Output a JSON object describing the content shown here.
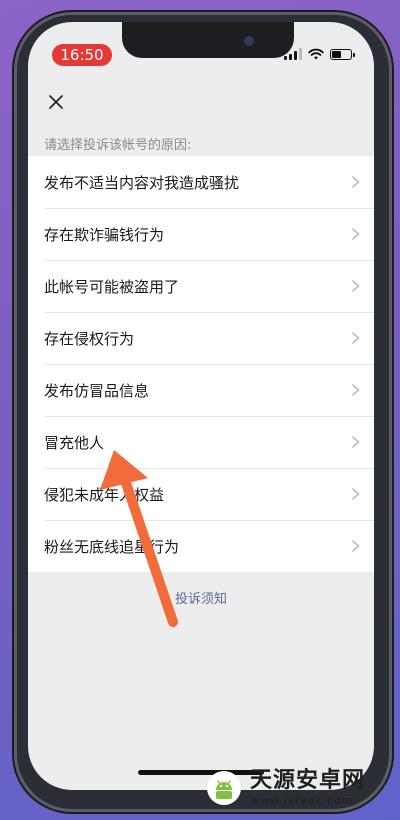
{
  "status_bar": {
    "time": "16:50",
    "battery_level": 0.5
  },
  "header": {
    "close_icon": "close-icon"
  },
  "hint": "请选择投诉该帐号的原因:",
  "reasons": [
    {
      "label": "发布不适当内容对我造成骚扰"
    },
    {
      "label": "存在欺诈骗钱行为"
    },
    {
      "label": "此帐号可能被盗用了"
    },
    {
      "label": "存在侵权行为"
    },
    {
      "label": "发布仿冒品信息"
    },
    {
      "label": "冒充他人"
    },
    {
      "label": "侵犯未成年人权益"
    },
    {
      "label": "粉丝无底线追星行为"
    }
  ],
  "footer_link": "投诉须知",
  "annotation": {
    "arrow_color": "#f26b3a"
  },
  "watermark": {
    "name": "天源安卓网",
    "url": "www.jytyaz.com"
  }
}
